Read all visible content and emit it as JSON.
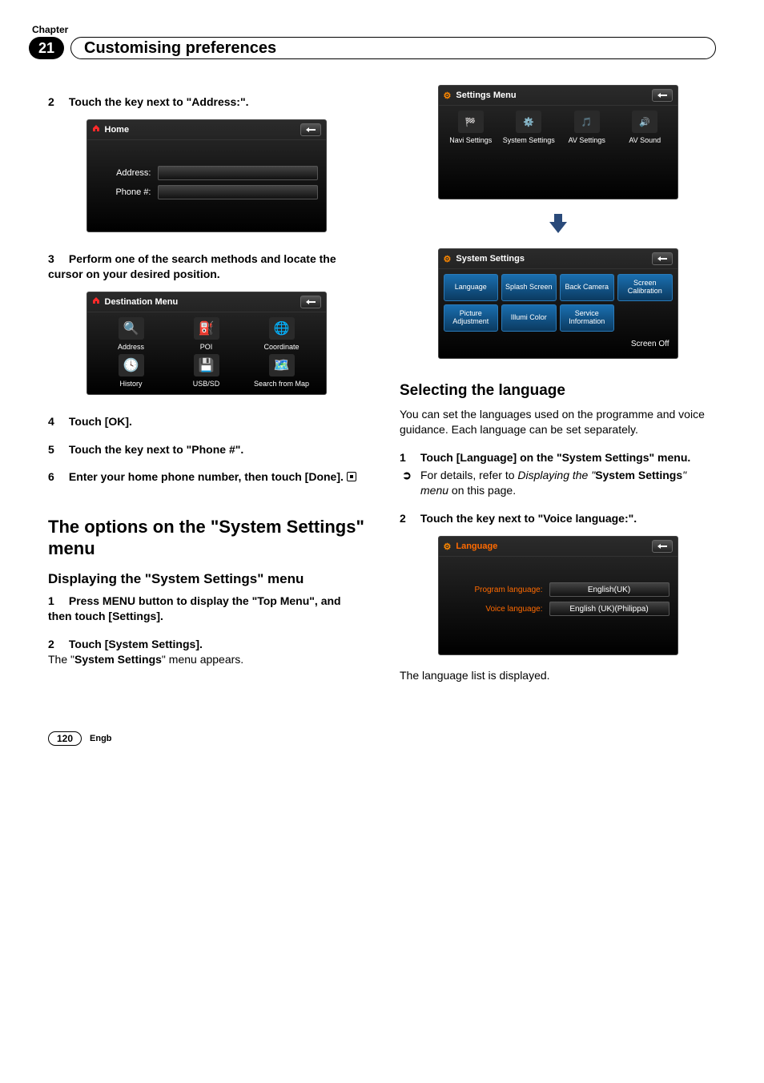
{
  "chapter_label": "Chapter",
  "chapter_number": "21",
  "page_title": "Customising preferences",
  "left": {
    "step2": "Touch the key next to \"Address:\".",
    "home_card": {
      "title": "Home",
      "address_label": "Address:",
      "phone_label": "Phone #:"
    },
    "step3": "Perform one of the search methods and locate the cursor on your desired position.",
    "dest_card": {
      "title": "Destination Menu",
      "items": [
        "Address",
        "POI",
        "Coordinate",
        "History",
        "USB/SD",
        "Search from Map"
      ]
    },
    "step4": "Touch [OK].",
    "step5": "Touch the key next to \"Phone #\".",
    "step6_a": "Enter your home phone number, then touch [Done].",
    "h2_a": "The options on the \"",
    "h2_b": "System Settings",
    "h2_c": "\" menu",
    "h3_a": "Displaying the \"",
    "h3_b": "System Settings",
    "h3_c": "\" menu",
    "disp_step1": "Press MENU button to display the \"Top Menu\", and then touch [Settings].",
    "disp_step2": "Touch [System Settings].",
    "disp_step2_after_a": "The \"",
    "disp_step2_after_b": "System Settings",
    "disp_step2_after_c": "\" menu appears."
  },
  "right": {
    "settings_card": {
      "title": "Settings Menu",
      "items": [
        "Navi Settings",
        "System Settings",
        "AV Settings",
        "AV Sound"
      ]
    },
    "sys_card": {
      "title": "System Settings",
      "buttons": [
        "Language",
        "Splash Screen",
        "Back Camera",
        "Screen Calibration",
        "Picture Adjustment",
        "Illumi Color",
        "Service Information"
      ],
      "screen_off": "Screen Off"
    },
    "section_title": "Selecting the language",
    "section_body": "You can set the languages used on the programme and voice guidance. Each language can be set separately.",
    "sel_step1": "Touch [Language] on the \"System Settings\" menu.",
    "sel_ref_a": "For details, refer to ",
    "sel_ref_b": "Displaying the \"",
    "sel_ref_c": "System Settings",
    "sel_ref_d": "\" menu",
    "sel_ref_e": " on this page.",
    "sel_step2": "Touch the key next to \"Voice language:\".",
    "lang_card": {
      "title": "Language",
      "program_label": "Program language:",
      "program_value": "English(UK)",
      "voice_label": "Voice language:",
      "voice_value": "English (UK)(Philippa)"
    },
    "closing": "The language list is displayed."
  },
  "footer": {
    "page": "120",
    "lang": "Engb"
  },
  "nums": {
    "n1": "1",
    "n2": "2",
    "n3": "3",
    "n4": "4",
    "n5": "5",
    "n6": "6"
  }
}
